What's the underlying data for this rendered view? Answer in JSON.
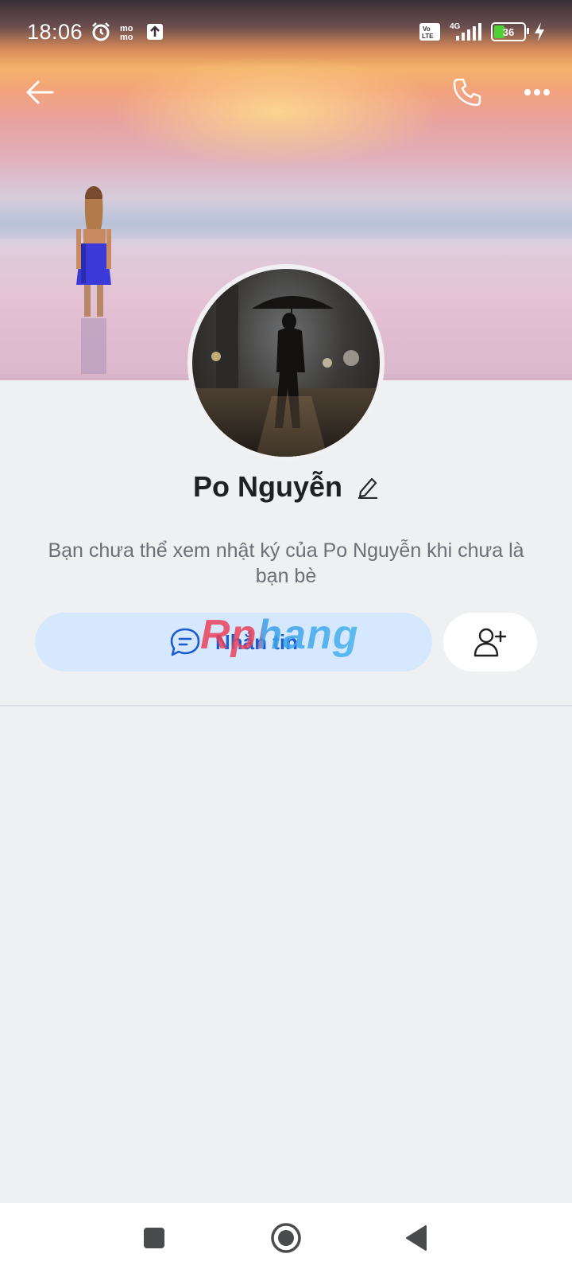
{
  "status_bar": {
    "time": "18:06",
    "network_label": "4G",
    "volte_label": "Vo LTE",
    "battery_level": "36",
    "icons": [
      "alarm-icon",
      "momo-icon",
      "upload-icon",
      "volte-icon",
      "signal-icon",
      "battery-icon",
      "charging-icon"
    ]
  },
  "toolbar": {
    "icons": [
      "back-arrow-icon",
      "phone-icon",
      "more-icon"
    ]
  },
  "profile": {
    "name": "Po Nguyễn",
    "edit_icon": "pencil-icon",
    "privacy_note": "Bạn chưa thể xem nhật ký của Po Nguyễn khi chưa là bạn bè"
  },
  "actions": {
    "message_label": "Nhắn tin",
    "message_icon": "chat-bubble-icon",
    "add_friend_icon": "add-user-icon"
  },
  "watermark": {
    "text": "Rphang"
  },
  "colors": {
    "accent": "#1b5dd1",
    "message_button_bg": "#d6e8fd",
    "page_bg": "#eef0f2"
  }
}
